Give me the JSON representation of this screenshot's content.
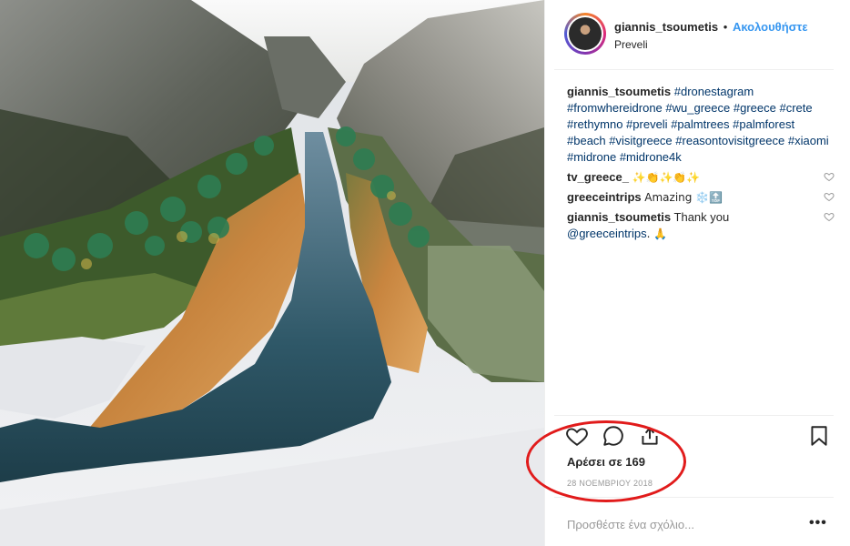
{
  "post": {
    "username": "giannis_tsoumetis",
    "separator": "•",
    "follow_label": "Ακολουθήστε",
    "location": "Preveli",
    "caption_tags": [
      "#dronestagram",
      "#fromwhereidrone",
      "#wu_greece",
      "#greece",
      "#crete",
      "#rethymno",
      "#preveli",
      "#palmtrees",
      "#palmforest",
      "#beach",
      "#visitgreece",
      "#reasontovisitgreece",
      "#xiaomi",
      "#midrone",
      "#midrone4k"
    ]
  },
  "comments": [
    {
      "user": "tv_greece_",
      "text": "✨👏✨👏✨"
    },
    {
      "user": "greeceintrips",
      "text": "Amazing ❄️🔝"
    },
    {
      "user": "giannis_tsoumetis",
      "text": "Thank you",
      "mention": "@greeceintrips",
      "suffix": ". 🙏"
    }
  ],
  "actions": {
    "like_icon": "heart-icon",
    "comment_icon": "comment-icon",
    "share_icon": "share-icon",
    "save_icon": "bookmark-icon"
  },
  "likes_text": "Αρέσει σε 169",
  "date_text": "28 ΝΟΕΜΒΡΙΟΥ 2018",
  "add_comment_placeholder": "Προσθέστε ένα σχόλιο...",
  "more_label": "•••",
  "colors": {
    "follow": "#3897f0",
    "tag": "#003569",
    "annotation": "#e11b1b"
  }
}
